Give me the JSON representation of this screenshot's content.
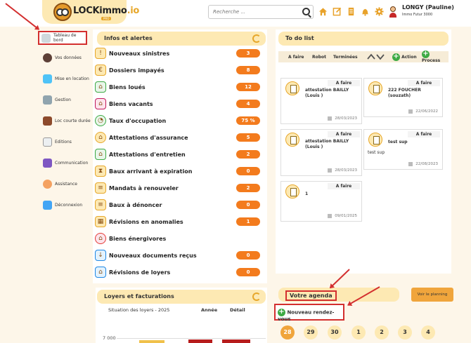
{
  "header": {
    "logo_text": "LOCKimmo",
    "logo_suffix": ".io",
    "logo_sub": "PRO",
    "search_placeholder": "Recherche ...",
    "user_name": "LONGY (Pauline)",
    "user_org": "Immo Futur 3000",
    "icons": [
      "home-icon",
      "edit-icon",
      "document-icon",
      "bell-icon",
      "gear-icon"
    ]
  },
  "sidebar": {
    "items": [
      {
        "label": "Tableau de bord",
        "active": true
      },
      {
        "label": "Vos données"
      },
      {
        "label": "Mise en location"
      },
      {
        "label": "Gestion"
      },
      {
        "label": "Loc courte durée"
      },
      {
        "label": "Editions"
      },
      {
        "label": "Communication"
      },
      {
        "label": "Assistance"
      },
      {
        "label": "Déconnexion"
      }
    ]
  },
  "infos": {
    "title": "Infos et alertes",
    "rows": [
      {
        "label": "Nouveaux sinistres",
        "count": "3"
      },
      {
        "label": "Dossiers impayés",
        "count": "8"
      },
      {
        "label": "Biens loués",
        "count": "12"
      },
      {
        "label": "Biens vacants",
        "count": "4"
      },
      {
        "label": "Taux d'occupation",
        "count": "75 %"
      },
      {
        "label": "Attestations d'assurance",
        "count": "5"
      },
      {
        "label": "Attestations d'entretien",
        "count": "2"
      },
      {
        "label": "Baux arrivant à expiration",
        "count": "0"
      },
      {
        "label": "Mandats à renouveler",
        "count": "2"
      },
      {
        "label": "Baux à dénoncer",
        "count": "0"
      },
      {
        "label": "Révisions en anomalies",
        "count": "1"
      },
      {
        "label": "Biens énergivores",
        "count": ""
      },
      {
        "label": "Nouveaux documents reçus",
        "count": "0"
      },
      {
        "label": "Révisions de loyers",
        "count": "0"
      }
    ]
  },
  "todo": {
    "title": "To do list",
    "filters": [
      "A faire",
      "Robot",
      "Terminées"
    ],
    "action_label": "Action",
    "process_label": "Process",
    "cards": [
      {
        "status": "A faire",
        "title": "attestation BAILLY (Louis )",
        "body": "",
        "date": "28/03/2023"
      },
      {
        "status": "A faire",
        "title": "222 FOUCHER (souzath)",
        "body": "",
        "date": "22/06/2022"
      },
      {
        "status": "A faire",
        "title": "attestation BAILLY (Louis )",
        "body": "",
        "date": "28/03/2023"
      },
      {
        "status": "A faire",
        "title": "test sup",
        "body": "test sup",
        "date": "22/08/2023"
      },
      {
        "status": "A faire",
        "title": "1",
        "body": "",
        "date": "09/01/2025"
      }
    ]
  },
  "loyers": {
    "title": "Loyers et facturations",
    "subtitle": "Situation des loyers - 2025",
    "col_annee": "Année",
    "col_detail": "Détail",
    "y_tick": "7 000"
  },
  "agenda": {
    "title": "Votre agenda",
    "planning_button": "Voir le planning",
    "new_rdv": "Nouveau rendez-vous",
    "days": [
      "28",
      "29",
      "30",
      "1",
      "2",
      "3",
      "4"
    ]
  },
  "colors": {
    "accent": "#f0a53c",
    "badge": "#f37b1d",
    "highlight": "#d32f2f",
    "panel_head": "#fde9b3"
  }
}
